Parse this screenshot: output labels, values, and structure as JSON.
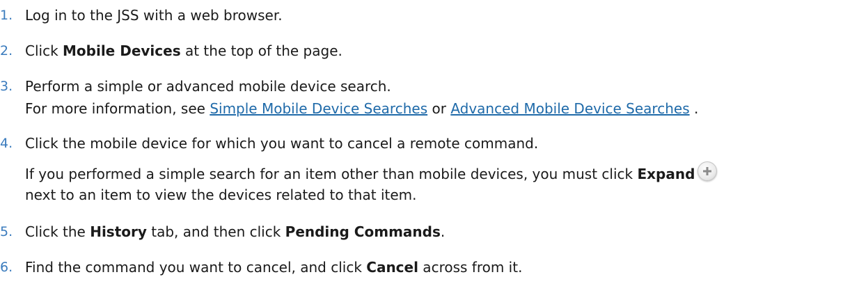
{
  "steps": [
    {
      "number": "1.",
      "text": "Log in to the JSS with a web browser."
    },
    {
      "number": "2.",
      "before": "Click ",
      "bold": "Mobile Devices",
      "after": " at the top of the page."
    },
    {
      "number": "3.",
      "text": "Perform a simple or advanced mobile device search.",
      "note_before": "For more information, see ",
      "link1": "Simple Mobile Device Searches",
      "note_mid": " or ",
      "link2": "Advanced Mobile Device Searches",
      "note_after": " ."
    },
    {
      "number": "4.",
      "text": "Click the mobile device for which you want to cancel a remote command.",
      "para_before": "If you performed a simple search for an item other than mobile devices, you must click ",
      "para_bold": "Expand",
      "para_line2": "next to an item to view the devices related to that item.",
      "icon": "plus-circle-icon"
    },
    {
      "number": "5.",
      "before": "Click the ",
      "bold1": "History",
      "mid": " tab, and then click ",
      "bold2": "Pending Commands",
      "after": "."
    },
    {
      "number": "6.",
      "before": "Find the command you want to cancel, and click ",
      "bold": "Cancel",
      "after": " across from it."
    }
  ]
}
